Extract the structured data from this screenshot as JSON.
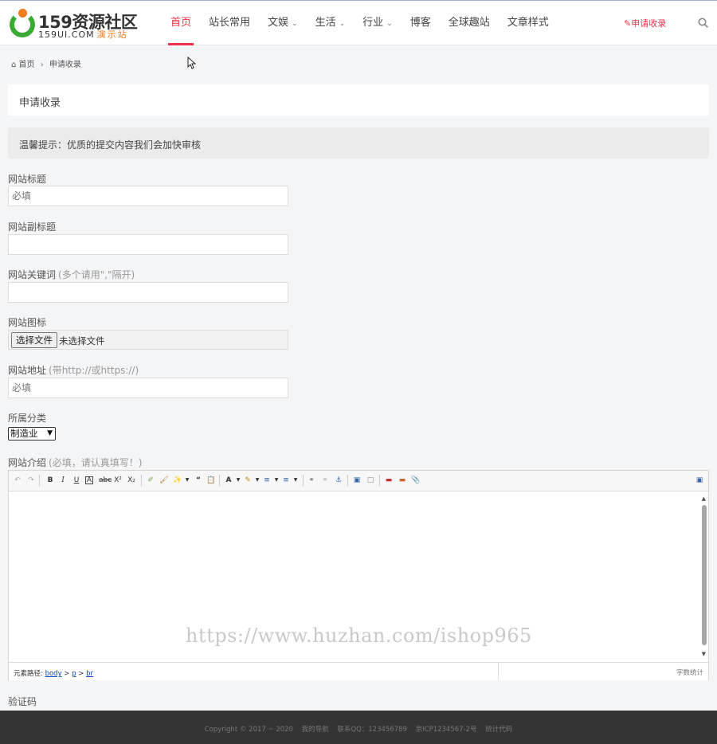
{
  "logo": {
    "main": "159资源社区",
    "sub": "159UI.COM",
    "sub_accent": "演示站"
  },
  "nav": {
    "items": [
      "首页",
      "站长常用",
      "文娱",
      "生活",
      "行业",
      "博客",
      "全球趣站",
      "文章样式"
    ],
    "active": "首页"
  },
  "header": {
    "submit_label": "申请收录"
  },
  "breadcrumb": {
    "home": "首页",
    "current": "申请收录"
  },
  "page": {
    "title": "申请收录",
    "notice": "温馨提示：优质的提交内容我们会加快审核"
  },
  "form": {
    "title_label": "网站标题",
    "title_placeholder": "必填",
    "subtitle_label": "网站副标题",
    "subtitle_value": "",
    "keywords_label": "网站关键词",
    "keywords_hint": "(多个请用\",\"隔开)",
    "keywords_value": "",
    "icon_label": "网站图标",
    "file_button": "选择文件",
    "file_status": "未选择文件",
    "url_label": "网站地址",
    "url_hint": "(带http://或https://)",
    "url_placeholder": "必填",
    "category_label": "所属分类",
    "category_selected": "制造业",
    "intro_label": "网站介绍",
    "intro_hint": "(必填，请认真填写！)",
    "captcha_label": "验证码"
  },
  "editor": {
    "path_label": "元素路径:",
    "path_body": "body",
    "path_p": "p",
    "path_br": "br",
    "word_count": "字数统计",
    "watermark": "https://www.huzhan.com/ishop965"
  },
  "footer": {
    "copyright": "Copyright © 2017 ~ 2020",
    "my_nav": "我的导航",
    "contact": "联系QQ：123456789",
    "icp": "京ICP1234567-2号",
    "stats": "统计代码"
  },
  "colors": {
    "accent": "#e8334a",
    "logo_green": "#3aaa35",
    "logo_orange": "#f07a1e",
    "footer_bg": "#343434"
  }
}
